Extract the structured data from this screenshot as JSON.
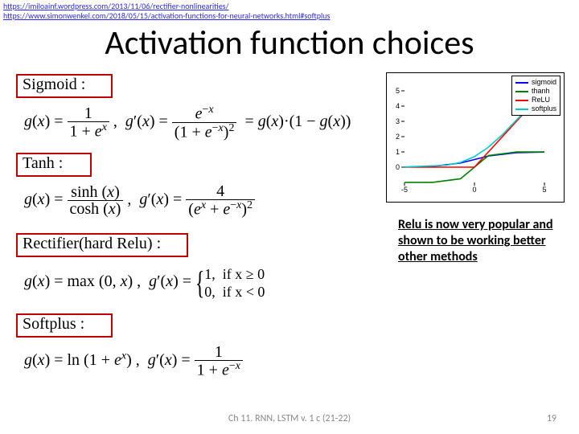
{
  "links": {
    "a": "https://imiloainf.wordpress.com/2013/11/06/rectifier-nonlinearities/",
    "b": "https://www.simonwenkel.com/2018/05/15/activation-functions-for-neural-networks.html#softplus"
  },
  "title": "Activation function choices",
  "heads": {
    "sigmoid": "Sigmoid :",
    "tanh": "Tanh :",
    "rect": "Rectifier(hard Relu) :",
    "soft": "Softplus :"
  },
  "legend": {
    "a": "sigmoid",
    "b": "thanh",
    "c": "ReLU",
    "d": "softplus"
  },
  "colors": {
    "a": "#0000ff",
    "b": "#008000",
    "c": "#ff0000",
    "d": "#00cccc"
  },
  "chart_data": {
    "type": "line",
    "xlim": [
      -5,
      5
    ],
    "ylim": [
      -1,
      5
    ],
    "series": [
      {
        "name": "sigmoid",
        "x": [
          -5,
          -3,
          -1,
          0,
          1,
          3,
          5
        ],
        "y": [
          0.01,
          0.05,
          0.27,
          0.5,
          0.73,
          0.95,
          0.99
        ]
      },
      {
        "name": "tanh",
        "x": [
          -5,
          -3,
          -1,
          0,
          1,
          3,
          5
        ],
        "y": [
          -1,
          -0.995,
          -0.76,
          0,
          0.76,
          0.995,
          1
        ]
      },
      {
        "name": "ReLU",
        "x": [
          -5,
          0,
          5
        ],
        "y": [
          0,
          0,
          5
        ]
      },
      {
        "name": "softplus",
        "x": [
          -5,
          -2,
          -1,
          0,
          1,
          2,
          5
        ],
        "y": [
          0.01,
          0.13,
          0.31,
          0.69,
          1.31,
          2.13,
          5.01
        ]
      }
    ]
  },
  "note": "Relu is now very popular and shown to be working better other methods",
  "footer": {
    "c": "Ch 11. RNN, LSTM  v. 1 c (21-22)",
    "r": "19"
  }
}
